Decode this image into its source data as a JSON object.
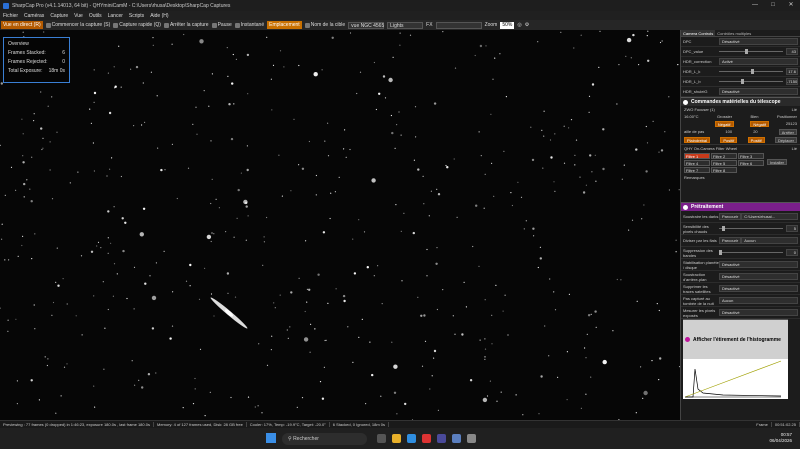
{
  "window": {
    "title": "SharpCap Pro (v4.1.14013, 64 bit) - QHYminiCamM - C:\\Users\\rhusa\\Desktop\\SharpCap Captures"
  },
  "menu": [
    "Fichier",
    "Caméras",
    "Capture",
    "Vue",
    "Outils",
    "Lancer",
    "Scripts",
    "Aide (H)"
  ],
  "toolbar": {
    "live": "Vue en direct (R)",
    "start_capture": "Commencer la capture (S)",
    "quick_capture": "Capture rapide (Q)",
    "stop_capture": "Arrêter la capture",
    "pause": "Pause",
    "snapshot": "Instantané",
    "placement": "Emplacement",
    "target_label": "Nom de la cible",
    "target_value": "vue NGC 4565",
    "frame_type": "Lights",
    "fx_label": "FX",
    "zoom_label": "Zoom",
    "zoom_value": "50%"
  },
  "overview": {
    "title": "Overview",
    "rows": [
      {
        "label": "Frames Stacked:",
        "value": "6"
      },
      {
        "label": "Frames Rejected:",
        "value": "0"
      },
      {
        "label": "Total Exposure:",
        "value": "18m 0s"
      }
    ]
  },
  "panel": {
    "tabs": [
      "Camera Controls",
      "Contrôles multiples"
    ],
    "camera_rows": [
      {
        "label": "DPC",
        "value": "Désactivé"
      },
      {
        "label": "DPC_value",
        "num": "43"
      },
      {
        "label": "HDR_correction",
        "value": "Activé"
      },
      {
        "label": "HDR_L_k",
        "num": "17.6"
      },
      {
        "label": "HDR_L_b",
        "num": "-7150"
      },
      {
        "label": "HDR_shuleiG",
        "value": "Désactivé"
      }
    ],
    "hardware_title": "Commandes matérielles du télescope",
    "focuser": {
      "name": "ZWO Focuser (1)",
      "connect": "Lié",
      "temp": "16.00°C",
      "coarse": "Grossier",
      "fine": "Bien",
      "position_label": "Positionner",
      "neg1": "Négatif",
      "neg2": "Négatif",
      "position": "25123",
      "step_label": "aille de pas",
      "step1": "100",
      "step2": "20",
      "stop": "Arrêter",
      "calibrate": "Plaindrebal",
      "pos1": "Positif",
      "pos2": "Positif",
      "move": "Déplacer"
    },
    "filter_wheel": {
      "name": "QHY On-Camera Filter Wheel",
      "connect": "Lié",
      "filters": [
        "Filtre 1",
        "Filtre 2",
        "Filtre 3",
        "Filtre 4",
        "Filtre 5",
        "Filtre 6",
        "Filtre 7",
        "Filtre 8"
      ],
      "install": "Installer",
      "notes": "Remarques"
    },
    "processing_title": "Prétraitement",
    "processing_rows": [
      {
        "label": "Soustraire les darks",
        "value": "Parcourir",
        "value2": "C:\\Users\\rhusa\\..."
      },
      {
        "label": "Sensibilité des pixels chauds",
        "num": "5"
      },
      {
        "label": "Diviser par les flats",
        "value": "Parcourir",
        "value2": "Aucun"
      },
      {
        "label": "Suppression des bandes",
        "num": "0"
      },
      {
        "label": "Stabilisation planète / disque",
        "value": "Désactivé"
      },
      {
        "label": "Soustraction d'arrière-plan",
        "value": "Désactivé"
      },
      {
        "label": "Supprimer les traces satellites",
        "value": "Désactivé"
      },
      {
        "label": "Pas capturé au tombée de la nuit",
        "value": "Aucun"
      },
      {
        "label": "Mesurer les pixels exposés",
        "value": "Désactivé"
      }
    ],
    "histogram_title": "Afficher l'étirement de l'histogramme"
  },
  "status": {
    "preview": "Previewing : 77 frames (0 dropped) in 1:46:23, exposure 180.0s , last frame 180.0s",
    "memory": "Memory: 4 of 127 frames used, Disk: 28 GB free",
    "cooler": "Cooler: 17%, Temp: -19.9°C, Target: -20.0°",
    "stacked": "6 Stacked, 0 Ignored, 18m 0s",
    "frame_label": "Frame",
    "frame_time": "00:51:02.25"
  },
  "taskbar": {
    "search": "Rechercher",
    "time": "00:57",
    "date": "06/04/2026"
  }
}
